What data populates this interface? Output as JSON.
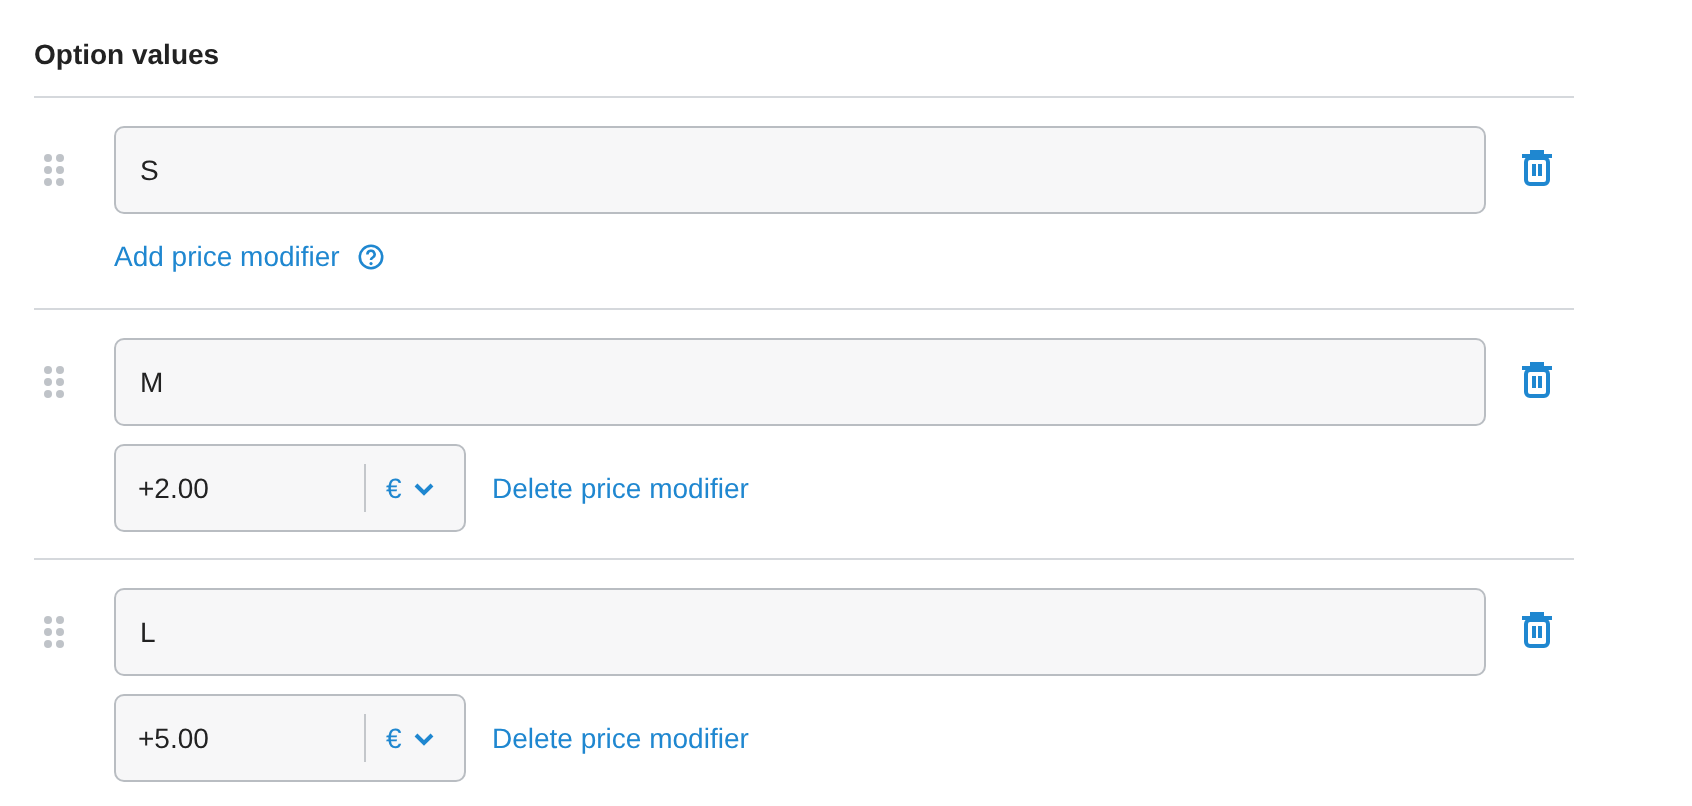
{
  "section": {
    "title": "Option values"
  },
  "values": [
    {
      "value": "S",
      "add_modifier": {
        "label": "Add price modifier"
      }
    },
    {
      "value": "M",
      "modifier": {
        "amount": "+2.00",
        "currency": "€",
        "delete_label": "Delete price modifier"
      }
    },
    {
      "value": "L",
      "modifier": {
        "amount": "+5.00",
        "currency": "€",
        "delete_label": "Delete price modifier"
      }
    }
  ]
}
